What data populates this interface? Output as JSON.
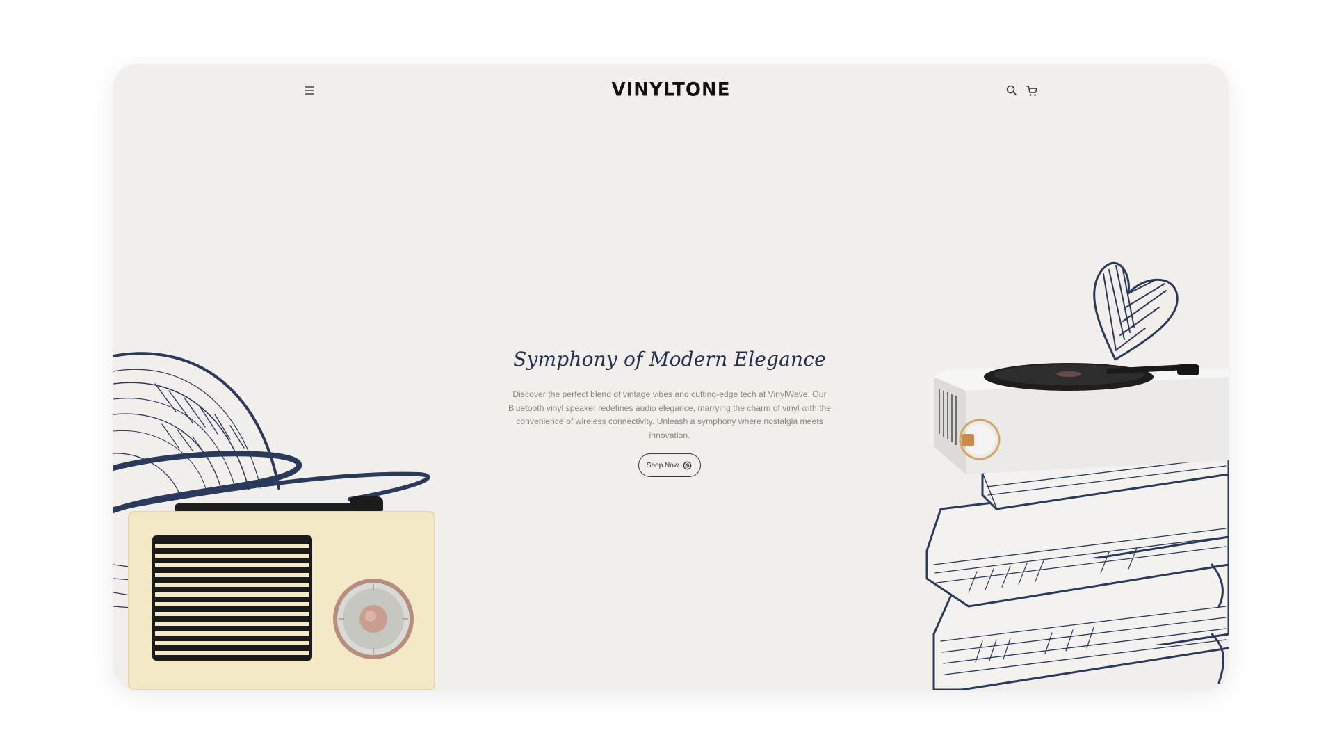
{
  "header": {
    "logo": "VINYLTONE",
    "menu_icon": "hamburger-menu-icon",
    "search_icon": "search-icon",
    "cart_icon": "shopping-cart-icon"
  },
  "hero": {
    "title": "Symphony of Modern Elegance",
    "description": "Discover the perfect blend of vintage vibes and cutting-edge tech at VinylWave. Our Bluetooth vinyl speaker redefines audio elegance, marrying the charm of vinyl with the convenience of wireless connectivity. Unleash a symphony where nostalgia meets innovation.",
    "cta_label": "Shop Now",
    "cta_icon": "vinyl-record-icon"
  },
  "colors": {
    "background": "#f1eeeb",
    "accent_navy": "#22304f",
    "text_muted": "#8a8680",
    "radio_cream": "#f3e9c6",
    "speaker_white": "#eceaea"
  }
}
